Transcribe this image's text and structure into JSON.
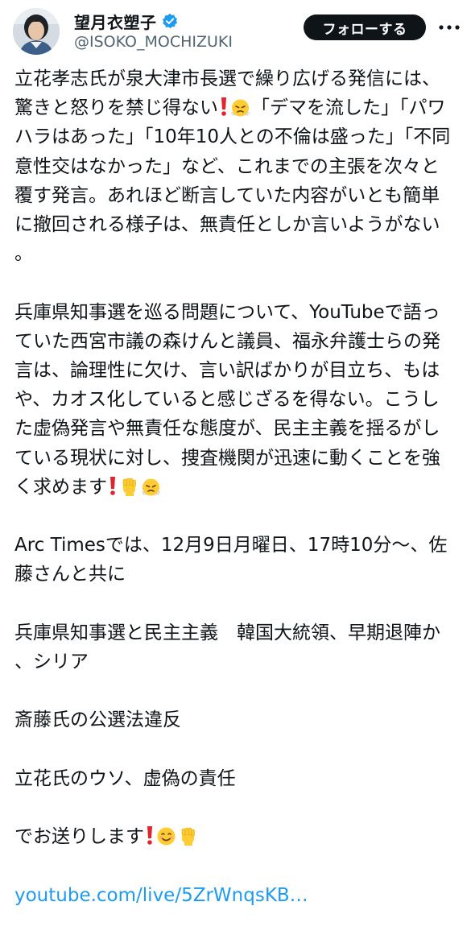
{
  "author": {
    "display_name": "望月衣塑子",
    "handle": "@ISOKO_MOCHIZUKI"
  },
  "actions": {
    "follow_label": "フォローする"
  },
  "tweet": {
    "p1a": "立花孝志氏が泉大津市長選で繰り広げる発信には、驚きと怒りを禁じ得ない",
    "p1b": "「デマを流した」「パワハラはあった」「10年10人との不倫は盛った」「不同意性交はなかった」など、これまでの主張を次々と覆す発言。あれほど断言していた内容がいとも簡単に撤回される様子は、無責任としか言いようがない。",
    "p2": "兵庫県知事選を巡る問題について、YouTubeで語っていた西宮市議の森けんと議員、福永弁護士らの発言は、論理性に欠け、言い訳ばかりが目立ち、もはや、カオス化していると感じざるを得ない。こうした虚偽発言や無責任な態度が、民主主義を揺るがしている現状に対し、捜査機関が迅速に動くことを強く求めます",
    "p3": "Arc Timesでは、12月9日月曜日、17時10分〜、佐藤さんと共に",
    "p4": "兵庫県知事選と民主主義　韓国大統領、早期退陣か、シリア",
    "p5": "斎藤氏の公選法違反",
    "p6": "立花氏のウソ、虚偽の責任",
    "p7": "でお送りします",
    "link": "youtube.com/live/5ZrWnqsKB…"
  },
  "icons": {
    "verified": "verified-badge-icon",
    "more": "more-dots-icon",
    "exclamation": "red-exclamation-icon",
    "steam_face": "face-with-steam-icon",
    "fist": "raised-fist-icon",
    "smile": "smiling-face-icon"
  },
  "colors": {
    "link": "#1d9bf0",
    "text": "#0f1419",
    "secondary": "#536471",
    "verified": "#1d9bf0",
    "follow_bg": "#0f1419",
    "exclamation": "#e0262d"
  }
}
